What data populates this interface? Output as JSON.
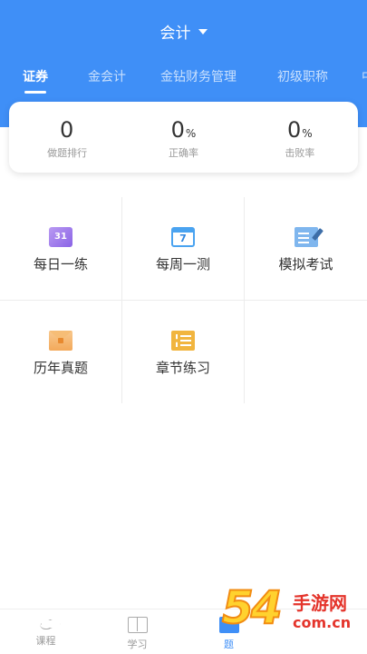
{
  "header": {
    "subject": "会计",
    "tabs": [
      {
        "label": "证券",
        "active": true
      },
      {
        "label": "金会计",
        "active": false
      },
      {
        "label": "金钻财务管理",
        "active": false
      },
      {
        "label": "初级职称",
        "active": false
      },
      {
        "label": "中",
        "active": false
      }
    ]
  },
  "stats": [
    {
      "value": "0",
      "unit": "",
      "label": "做题排行"
    },
    {
      "value": "0",
      "unit": "%",
      "label": "正确率"
    },
    {
      "value": "0",
      "unit": "%",
      "label": "击败率"
    }
  ],
  "grid": [
    {
      "label": "每日一练",
      "icon": "calendar-31-icon",
      "icon_text": "31",
      "color": "#8a63e6"
    },
    {
      "label": "每周一测",
      "icon": "calendar-7-icon",
      "icon_text": "7",
      "color": "#4aa3f0"
    },
    {
      "label": "模拟考试",
      "icon": "edit-icon",
      "color": "#7fb6ee"
    },
    {
      "label": "历年真题",
      "icon": "envelope-icon",
      "color": "#f3a95a"
    },
    {
      "label": "章节练习",
      "icon": "ticket-icon",
      "color": "#f1b53f"
    }
  ],
  "bottom_nav": [
    {
      "label": "课程",
      "icon": "graduation-cap-icon",
      "active": false
    },
    {
      "label": "学习",
      "icon": "book-icon",
      "active": false
    },
    {
      "label": "题",
      "icon": "quiz-icon",
      "active": true
    }
  ],
  "watermark": {
    "number": "54",
    "text": "手游网",
    "url": "com.cn"
  },
  "colors": {
    "primary": "#3f8ff7",
    "text": "#333333",
    "muted": "#999999"
  }
}
